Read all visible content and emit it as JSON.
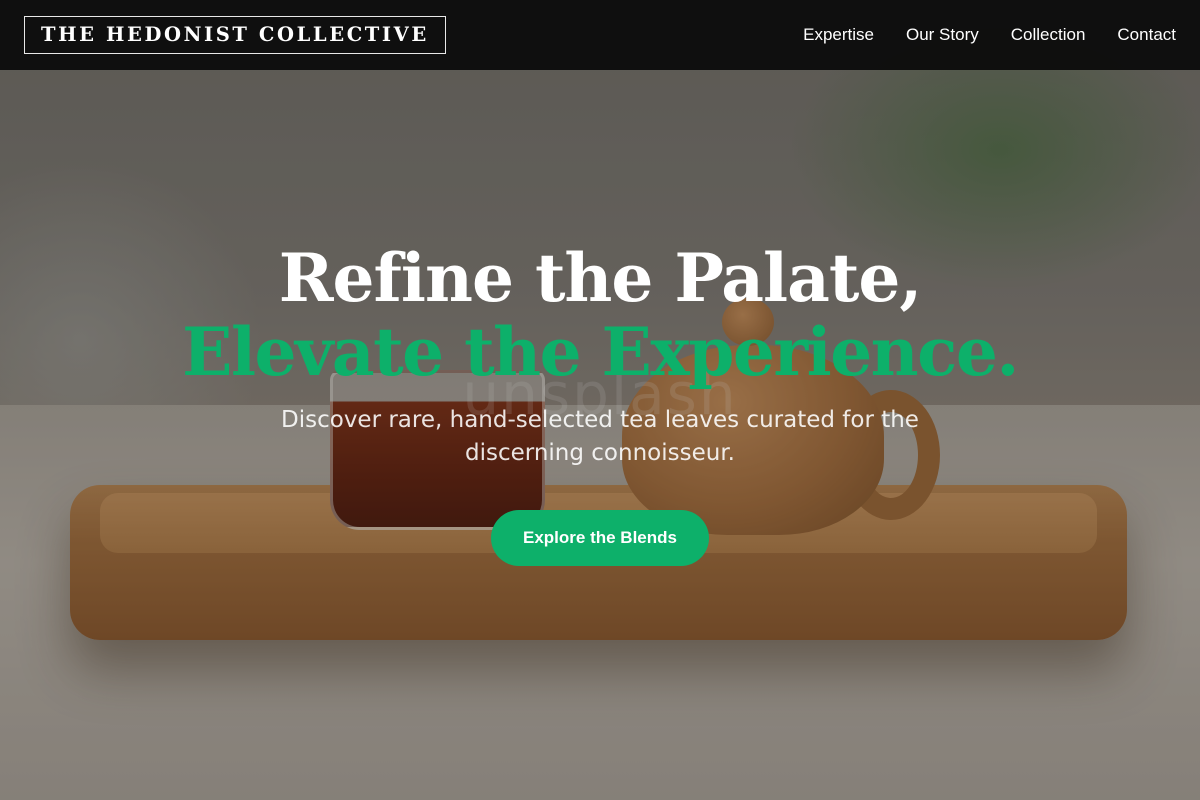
{
  "brand": {
    "logo_text": "THE HEDONIST COLLECTIVE"
  },
  "nav": {
    "items": [
      {
        "label": "Expertise"
      },
      {
        "label": "Our Story"
      },
      {
        "label": "Collection"
      },
      {
        "label": "Contact"
      }
    ]
  },
  "hero": {
    "headline_line1": "Refine the Palate,",
    "headline_line2": "Elevate the Experience.",
    "subtitle": "Discover rare, hand-selected tea leaves curated for the discerning connoisseur.",
    "cta_label": "Explore the Blends",
    "background_watermark": "unsplash"
  },
  "colors": {
    "accent": "#0db06a",
    "navbar": "#0a0a0a",
    "text_light": "#ffffff"
  }
}
